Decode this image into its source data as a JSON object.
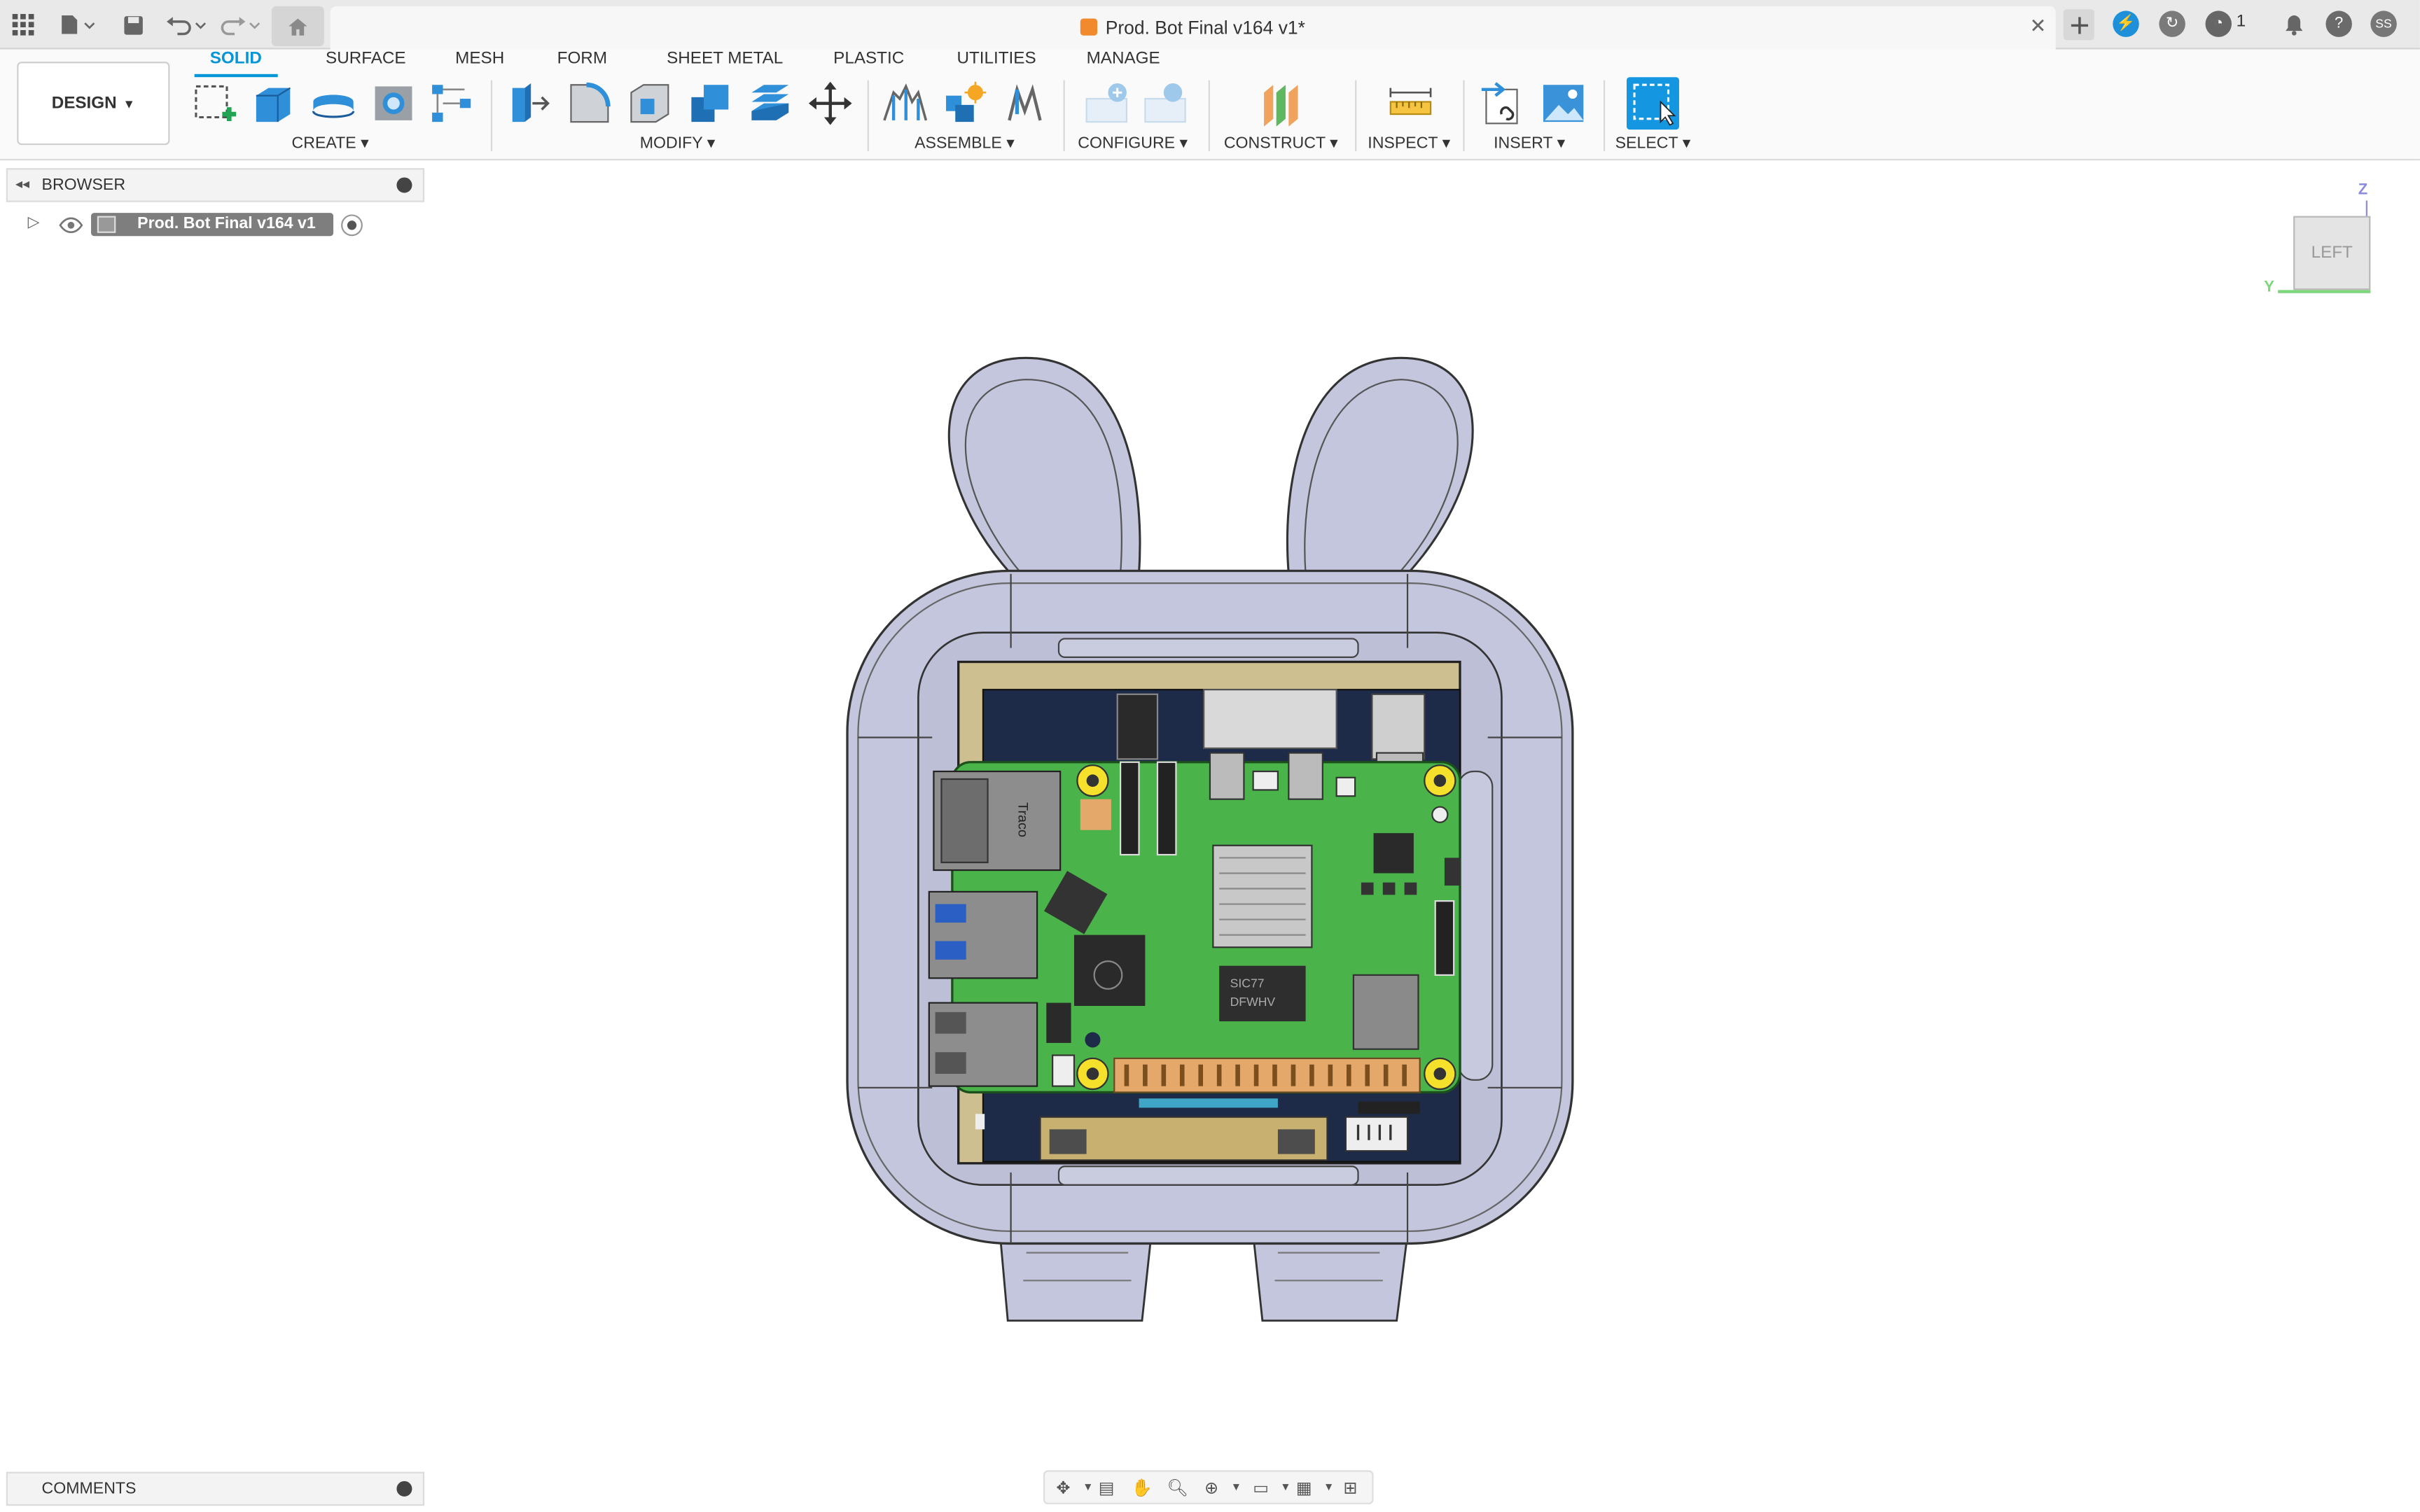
{
  "window": {
    "doc_title": "Prod. Bot Final v164 v1*",
    "job_count": "1"
  },
  "toolbar": {
    "workspace_label": "DESIGN",
    "tabs": [
      "SOLID",
      "SURFACE",
      "MESH",
      "FORM",
      "SHEET METAL",
      "PLASTIC",
      "UTILITIES",
      "MANAGE"
    ],
    "active_tab": "SOLID",
    "groups": [
      "CREATE",
      "MODIFY",
      "ASSEMBLE",
      "CONFIGURE",
      "CONSTRUCT",
      "INSPECT",
      "INSERT",
      "SELECT"
    ]
  },
  "browser": {
    "title": "BROWSER",
    "root_item": "Prod. Bot Final v164 v1"
  },
  "comments": {
    "title": "COMMENTS"
  },
  "viewcube": {
    "face_label": "LEFT",
    "axis_z": "Z",
    "axis_y": "Y"
  },
  "pcb": {
    "chip_labels": [
      "Traco",
      "SIC77",
      "DFWHV"
    ]
  },
  "colors": {
    "accent": "#0696d7",
    "body": "#c3c6dc",
    "pcb": "#4ab34a",
    "frame": "#cdbf8f",
    "board_dark": "#1d2b48"
  },
  "icons": [
    "grid-icon",
    "file-icon",
    "save-icon",
    "undo-icon",
    "redo-icon",
    "home-icon",
    "close-icon",
    "add-tab-icon",
    "extensions-icon",
    "data-panel-icon",
    "job-status-icon",
    "bell-icon",
    "help-icon",
    "account-icon"
  ]
}
